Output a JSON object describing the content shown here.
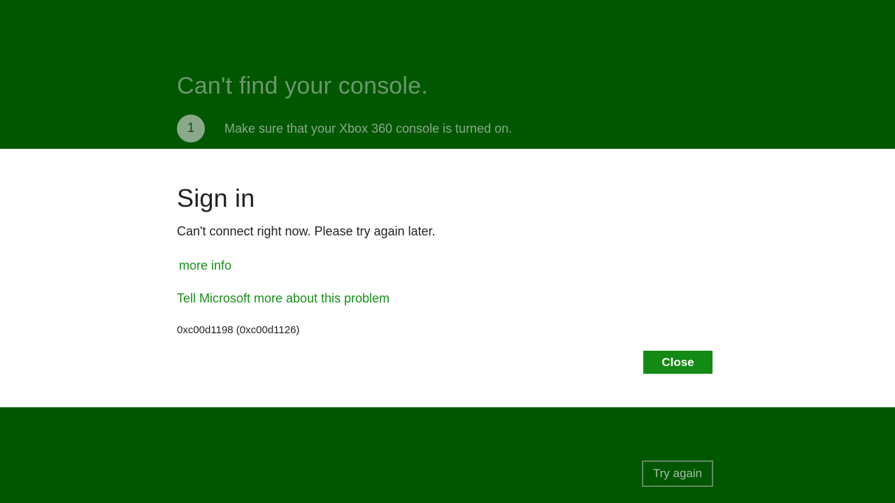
{
  "header": {
    "title": "Can't find your console.",
    "step_number": "1",
    "step_text": "Make sure that your Xbox 360 console is turned on."
  },
  "dialog": {
    "title": "Sign in",
    "message": "Can't connect right now. Please try again later.",
    "more_info_label": "more info",
    "report_label": "Tell Microsoft more about this problem",
    "error_code": "0xc00d1198 (0xc00d1126)",
    "close_label": "Close"
  },
  "footer": {
    "try_again_label": "Try again"
  },
  "colors": {
    "brand_green": "#005700",
    "link_green": "#179017",
    "button_green": "#138a13"
  }
}
